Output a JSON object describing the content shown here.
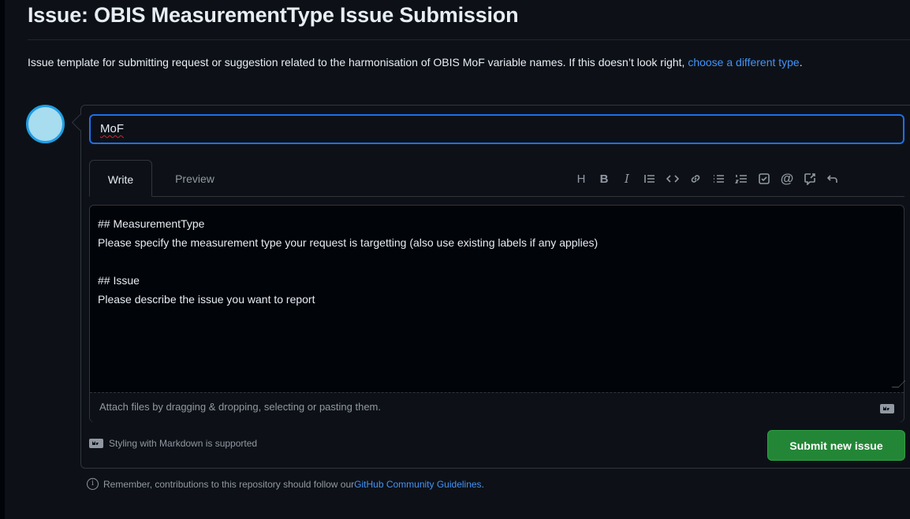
{
  "header": {
    "title": "Issue: OBIS MeasurementType Issue Submission",
    "description": "Issue template for submitting request or suggestion related to the harmonisation of OBIS MoF variable names. If this doesn’t look right, ",
    "change_link": "choose a different type",
    "description_end": "."
  },
  "form": {
    "title_value": "MoF",
    "tabs": [
      {
        "label": "Write",
        "active": true
      },
      {
        "label": "Preview",
        "active": false
      }
    ],
    "toolbar": [
      {
        "icon": "heading-icon",
        "glyph": "H"
      },
      {
        "icon": "bold-icon",
        "glyph": "B"
      },
      {
        "icon": "italic-icon",
        "glyph": "I"
      },
      {
        "icon": "quote-icon",
        "glyph": ""
      },
      {
        "icon": "code-icon",
        "glyph": ""
      },
      {
        "icon": "link-icon",
        "glyph": ""
      },
      {
        "icon": "unordered-list-icon",
        "glyph": ""
      },
      {
        "icon": "ordered-list-icon",
        "glyph": ""
      },
      {
        "icon": "task-list-icon",
        "glyph": ""
      },
      {
        "icon": "mention-icon",
        "glyph": "@"
      },
      {
        "icon": "reference-icon",
        "glyph": ""
      },
      {
        "icon": "undo-icon",
        "glyph": ""
      }
    ],
    "body_lines": [
      "## MeasurementType",
      "Please specify the measurement type your request is targetting (also use existing labels if any applies)",
      "",
      "## Issue",
      "Please describe the issue you want to report"
    ],
    "attach_hint": "Attach files by dragging & dropping, selecting or pasting them.",
    "markdown_note": "Styling with Markdown is supported",
    "submit_label": "Submit new issue"
  },
  "footer": {
    "note": "Remember, contributions to this repository should follow our ",
    "guidelines_link": "GitHub Community Guidelines",
    "note_end": "."
  },
  "colors": {
    "background": "#0d1117",
    "accent_link": "#4493f8",
    "submit_green": "#238636",
    "focus_border": "#1f6feb",
    "avatar": "#a8dcef"
  }
}
